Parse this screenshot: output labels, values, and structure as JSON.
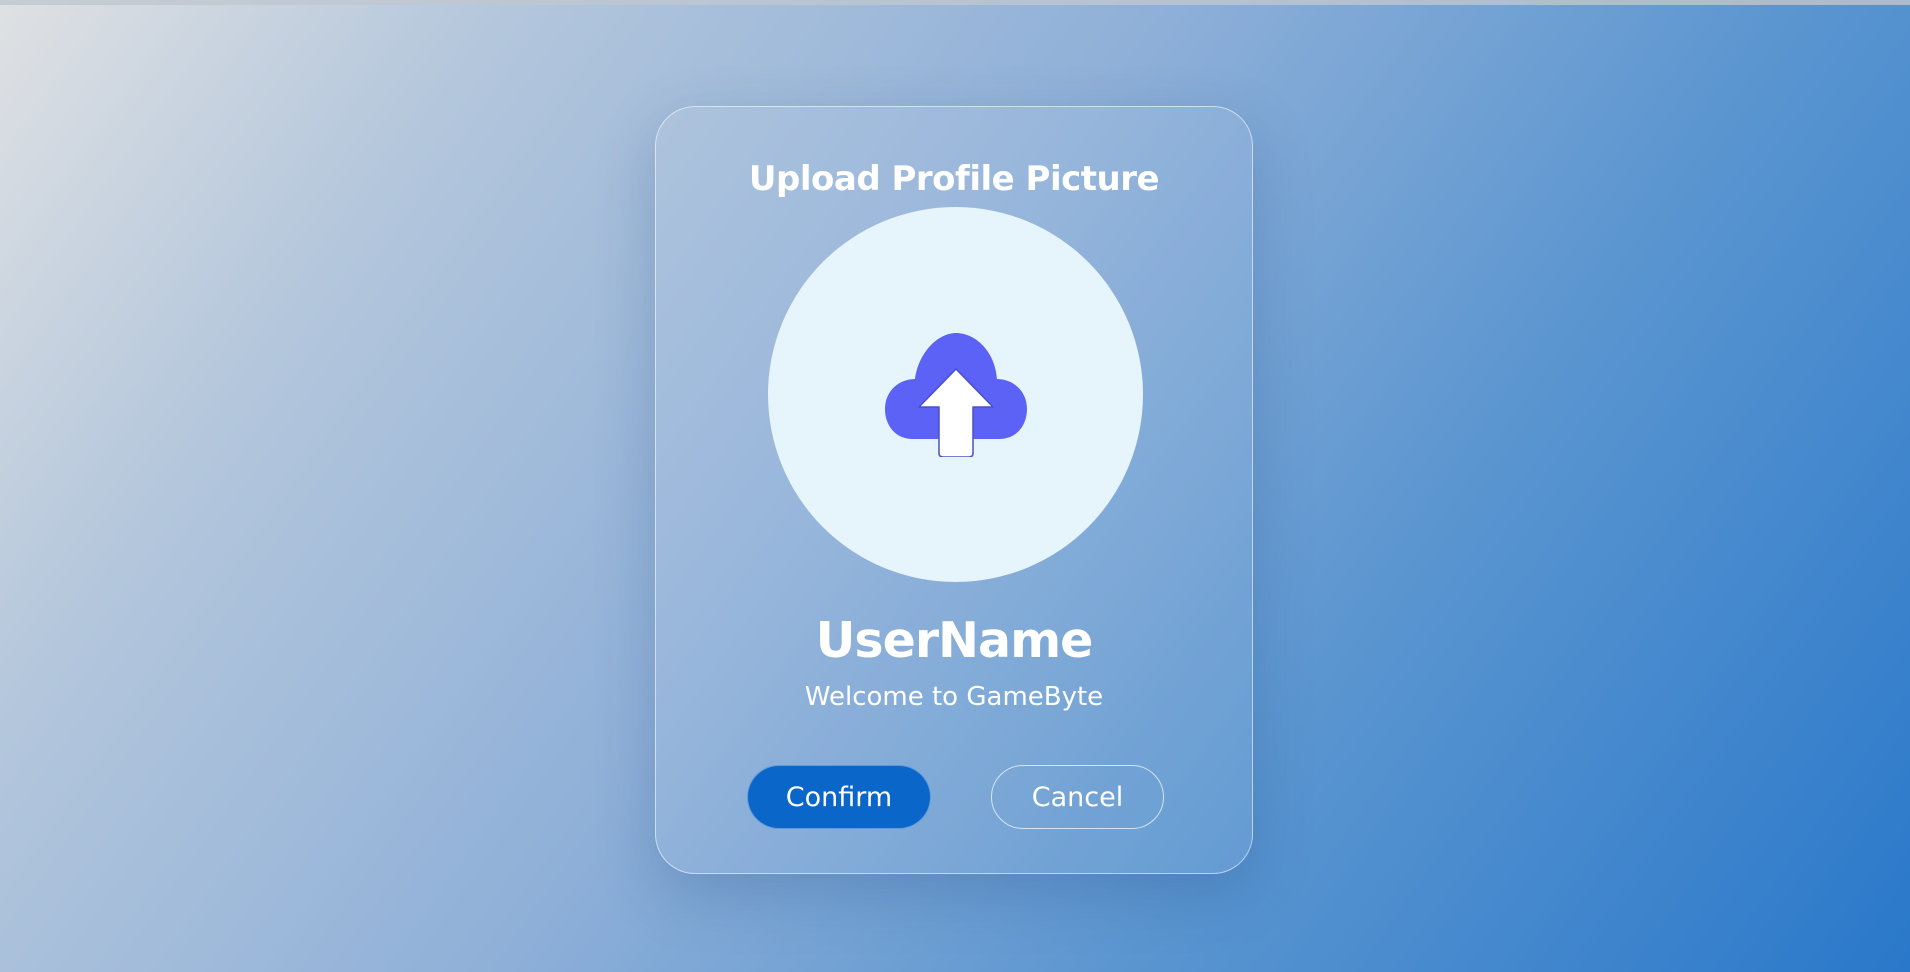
{
  "upload_card": {
    "title": "Upload Profile Picture",
    "upload_icon": "cloud-upload-icon",
    "username": "UserName",
    "welcome": "Welcome to GameByte",
    "confirm_label": "Confirm",
    "cancel_label": "Cancel"
  },
  "colors": {
    "background_start": "#dfe1e3",
    "background_end": "#2a78ca",
    "avatar_fill": "#e6f4fc",
    "icon_cloud": "#5b62f5",
    "confirm_button": "#0a66c8"
  }
}
